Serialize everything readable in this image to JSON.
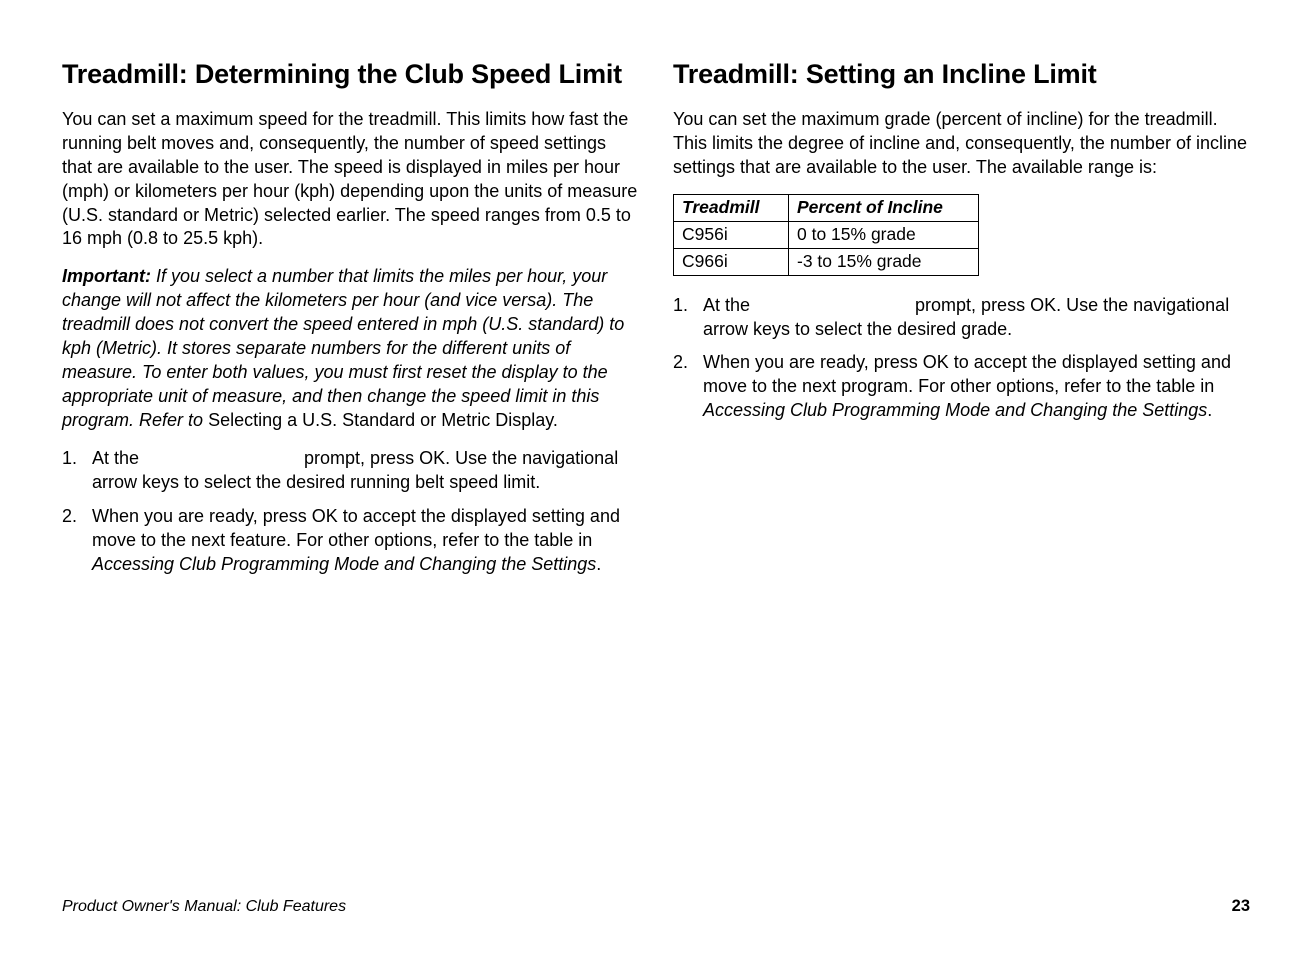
{
  "left": {
    "heading": "Treadmill: Determining the Club Speed Limit",
    "para1": "You can set a maximum speed for the treadmill. This limits how fast the running belt moves and, consequently, the number of speed settings that are available to the user. The speed is displayed in miles per hour (mph) or kilometers per hour (kph) depending upon the units of measure (U.S. standard or Metric) selected earlier. The speed ranges from 0.5 to 16 mph (0.8 to 25.5 kph).",
    "important_label": "Important:",
    "important_italic": " If you select a number that limits the miles per hour, your change will not affect the kilometers per hour (and vice versa). The treadmill does not convert the speed entered in mph (U.S. standard) to kph (Metric). It stores separate numbers for the different units of measure. To enter both values, you must first reset the display to the appropriate unit of measure, and then change the speed limit in this program. Refer to ",
    "important_tail": "Selecting a U.S. Standard or Metric Display.",
    "step1_a": "At the ",
    "step1_b": " prompt, press OK. Use the navigational arrow keys to select the desired running belt speed limit.",
    "step2_a": "When you are ready, press OK to accept the displayed setting and move to the next feature. For other options, refer to the table in ",
    "step2_italic": "Accessing Club Programming Mode and Changing the Settings",
    "step2_c": "."
  },
  "right": {
    "heading": "Treadmill: Setting an Incline Limit",
    "para1": "You can set the maximum grade (percent of incline) for the treadmill. This limits the degree of incline and, consequently, the number of incline settings that are available to the user. The available range is:",
    "table": {
      "headers": [
        "Treadmill",
        "Percent of Incline"
      ],
      "rows": [
        [
          "C956i",
          "0 to 15% grade"
        ],
        [
          "C966i",
          "-3 to 15% grade"
        ]
      ]
    },
    "step1_a": "At the ",
    "step1_b": " prompt, press OK. Use the navigational arrow keys to select the desired grade.",
    "step2_a": "When you are ready, press OK to accept the displayed setting and move to the next program. For other options, refer to the table in ",
    "step2_italic": "Accessing Club Programming Mode and Changing the Settings",
    "step2_c": "."
  },
  "footer": {
    "left": "Product Owner's Manual: Club Features",
    "page": "23"
  }
}
